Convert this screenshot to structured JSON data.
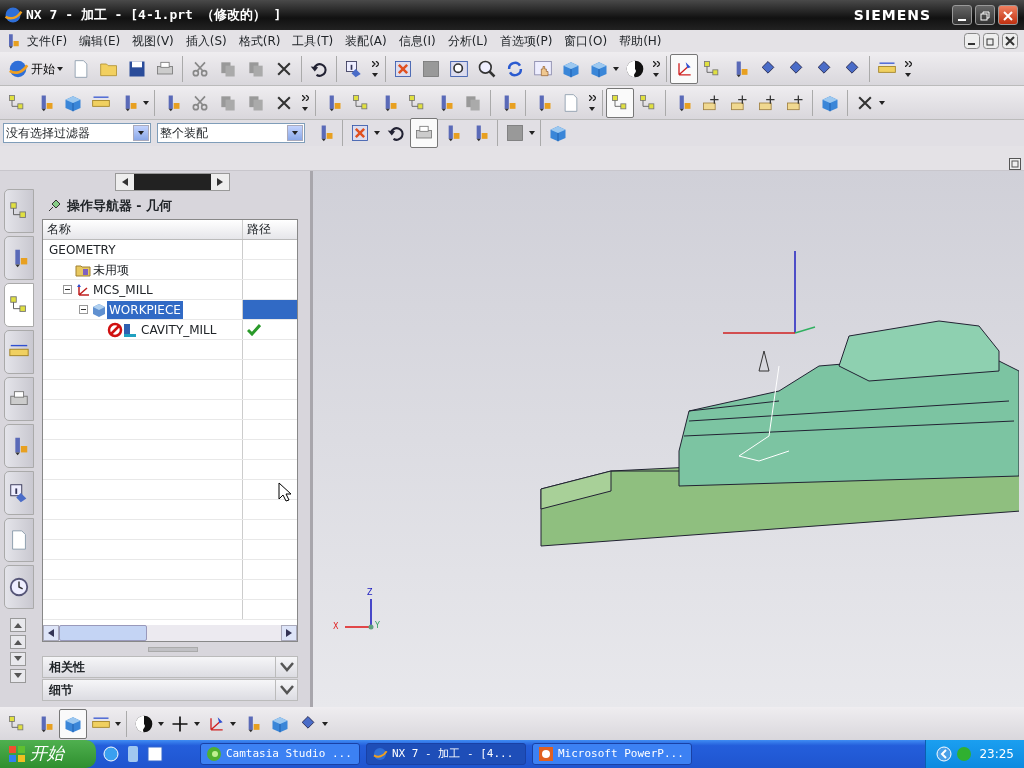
{
  "window": {
    "title": "NX 7 - 加工 - [4-1.prt （修改的） ]",
    "brand": "SIEMENS"
  },
  "menu": [
    "文件(F)",
    "编辑(E)",
    "视图(V)",
    "插入(S)",
    "格式(R)",
    "工具(T)",
    "装配(A)",
    "信息(I)",
    "分析(L)",
    "首选项(P)",
    "窗口(O)",
    "帮助(H)"
  ],
  "toolbars": [
    [
      {
        "kind": "start",
        "label": "开始",
        "pressed": false
      },
      {
        "kind": "page",
        "pressed": false
      },
      {
        "kind": "folder",
        "pressed": false
      },
      {
        "kind": "disk",
        "pressed": false
      },
      {
        "kind": "printer",
        "pressed": false
      },
      {
        "kind": "sep"
      },
      {
        "kind": "scissors",
        "pressed": false
      },
      {
        "kind": "copy",
        "pressed": false
      },
      {
        "kind": "copy",
        "pressed": false
      },
      {
        "kind": "cross",
        "pressed": false
      },
      {
        "kind": "sep"
      },
      {
        "kind": "undo",
        "pressed": false
      },
      {
        "kind": "sep"
      },
      {
        "kind": "info",
        "pressed": false
      },
      {
        "kind": "overflow"
      },
      {
        "kind": "sep"
      },
      {
        "kind": "fit",
        "pressed": false
      },
      {
        "kind": "graybox",
        "pressed": false
      },
      {
        "kind": "zoombox",
        "pressed": false
      },
      {
        "kind": "zoom",
        "pressed": false
      },
      {
        "kind": "rotate",
        "pressed": false
      },
      {
        "kind": "hand",
        "pressed": false
      },
      {
        "kind": "cube",
        "pressed": false
      },
      {
        "kind": "cube",
        "pressed": false
      },
      {
        "kind": "dropdown"
      },
      {
        "kind": "sphere",
        "pressed": false
      },
      {
        "kind": "overflow"
      },
      {
        "kind": "sep"
      },
      {
        "kind": "axes",
        "pressed": true
      },
      {
        "kind": "tree",
        "pressed": false
      },
      {
        "kind": "tool",
        "pressed": false
      },
      {
        "kind": "diamond",
        "pressed": false
      },
      {
        "kind": "diamond",
        "pressed": false
      },
      {
        "kind": "diamond",
        "pressed": false
      },
      {
        "kind": "diamond",
        "pressed": false
      },
      {
        "kind": "sep"
      },
      {
        "kind": "ruler",
        "pressed": false
      },
      {
        "kind": "overflow"
      }
    ],
    [
      {
        "kind": "tree",
        "pressed": false
      },
      {
        "kind": "tool",
        "pressed": false
      },
      {
        "kind": "cube",
        "pressed": false
      },
      {
        "kind": "ruler",
        "pressed": false
      },
      {
        "kind": "tool",
        "pressed": false
      },
      {
        "kind": "dropdown"
      },
      {
        "kind": "sep"
      },
      {
        "kind": "tool",
        "pressed": false
      },
      {
        "kind": "scissors",
        "pressed": false
      },
      {
        "kind": "copy",
        "pressed": false
      },
      {
        "kind": "copy",
        "pressed": false
      },
      {
        "kind": "cross",
        "pressed": false
      },
      {
        "kind": "overflow"
      },
      {
        "kind": "sep"
      },
      {
        "kind": "tool",
        "pressed": false
      },
      {
        "kind": "tree",
        "pressed": false
      },
      {
        "kind": "tool",
        "pressed": false
      },
      {
        "kind": "tree",
        "pressed": false
      },
      {
        "kind": "tool",
        "pressed": false
      },
      {
        "kind": "copy",
        "pressed": false
      },
      {
        "kind": "sep"
      },
      {
        "kind": "tool",
        "pressed": false
      },
      {
        "kind": "sep"
      },
      {
        "kind": "tool",
        "pressed": false
      },
      {
        "kind": "page",
        "pressed": false
      },
      {
        "kind": "overflow"
      },
      {
        "kind": "sep"
      },
      {
        "kind": "tree",
        "pressed": true
      },
      {
        "kind": "tree",
        "pressed": false
      },
      {
        "kind": "sep"
      },
      {
        "kind": "tool",
        "pressed": false
      },
      {
        "kind": "tag",
        "pressed": false
      },
      {
        "kind": "tag",
        "pressed": false
      },
      {
        "kind": "tag",
        "pressed": false
      },
      {
        "kind": "tag",
        "pressed": false
      },
      {
        "kind": "sep"
      },
      {
        "kind": "cube",
        "pressed": false
      },
      {
        "kind": "sep"
      },
      {
        "kind": "cross",
        "pressed": false
      },
      {
        "kind": "dropdown"
      }
    ]
  ],
  "filters": [
    {
      "value": "没有选择过滤器"
    },
    {
      "value": "整个装配"
    }
  ],
  "filter_tools": [
    {
      "kind": "tool",
      "pressed": false
    },
    {
      "kind": "sep"
    },
    {
      "kind": "fit",
      "pressed": false
    },
    {
      "kind": "dropdown"
    },
    {
      "kind": "undo",
      "pressed": false
    },
    {
      "kind": "printer",
      "pressed": true
    },
    {
      "kind": "tool",
      "pressed": false
    },
    {
      "kind": "tool",
      "pressed": false
    },
    {
      "kind": "sep"
    },
    {
      "kind": "graybox",
      "pressed": false
    },
    {
      "kind": "dropdown"
    },
    {
      "kind": "sep"
    },
    {
      "kind": "cube",
      "pressed": false
    }
  ],
  "side_tabs": [
    {
      "kind": "tree",
      "selected": false
    },
    {
      "kind": "tool",
      "selected": false
    },
    {
      "kind": "tree",
      "selected": true
    },
    {
      "kind": "ruler",
      "selected": false
    },
    {
      "kind": "printer",
      "selected": false
    },
    {
      "kind": "tool",
      "selected": false
    },
    {
      "kind": "info",
      "selected": false
    },
    {
      "kind": "page",
      "selected": false
    },
    {
      "kind": "clock",
      "selected": false
    }
  ],
  "navigator": {
    "title": "操作导航器 - 几何",
    "columns": [
      "名称",
      "路径"
    ],
    "tree": [
      {
        "label": "GEOMETRY",
        "kind": "root",
        "selected": false,
        "children": [
          {
            "label": "未用项",
            "kind": "folder",
            "selected": false
          },
          {
            "label": "MCS_MILL",
            "kind": "mcs",
            "selected": false,
            "expanded": true,
            "children": [
              {
                "label": "WORKPIECE",
                "kind": "workpiece",
                "selected": true,
                "expanded": true,
                "children": [
                  {
                    "label": "CAVITY_MILL",
                    "kind": "operation",
                    "selected": false,
                    "path_ok": true
                  }
                ]
              }
            ]
          }
        ]
      }
    ],
    "sections": [
      {
        "label": "相关性",
        "expanded": false
      },
      {
        "label": "细节",
        "expanded": false
      }
    ]
  },
  "viewport": {
    "triad_labels": [
      "Z",
      "X",
      "Y"
    ]
  },
  "bottom_toolbar": [
    {
      "kind": "tree",
      "pressed": false
    },
    {
      "kind": "tool",
      "pressed": false
    },
    {
      "kind": "cube",
      "pressed": true
    },
    {
      "kind": "ruler",
      "pressed": false
    },
    {
      "kind": "dropdown"
    },
    {
      "kind": "sep"
    },
    {
      "kind": "sphere",
      "pressed": false
    },
    {
      "kind": "dropdown"
    },
    {
      "kind": "plus",
      "pressed": false
    },
    {
      "kind": "dropdown"
    },
    {
      "kind": "axes",
      "pressed": false
    },
    {
      "kind": "dropdown"
    },
    {
      "kind": "tool",
      "pressed": false
    },
    {
      "kind": "cube",
      "pressed": false
    },
    {
      "kind": "diamond",
      "pressed": false
    },
    {
      "kind": "dropdown"
    }
  ],
  "taskbar": {
    "start": "开始",
    "tasks": [
      {
        "label": "Camtasia Studio ...",
        "kind": "camtasia",
        "selected": false
      },
      {
        "label": "NX 7 - 加工 - [4...",
        "kind": "nx",
        "selected": true
      },
      {
        "label": "Microsoft PowerP...",
        "kind": "powerpoint",
        "selected": false
      }
    ],
    "clock": "23:25"
  }
}
